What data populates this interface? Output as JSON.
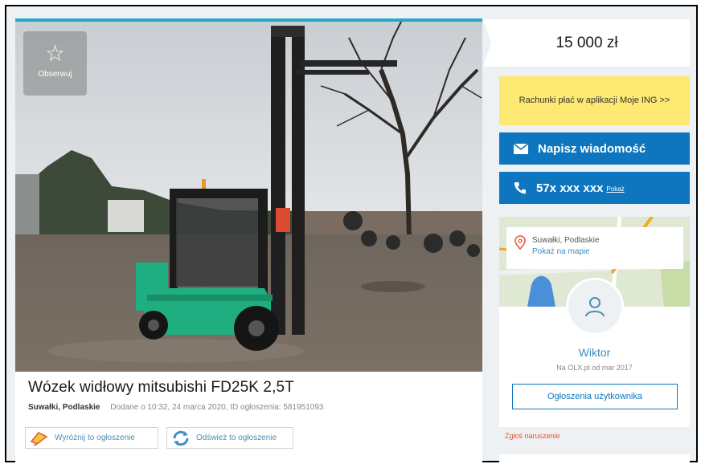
{
  "listing": {
    "title": "Wózek widłowy mitsubishi FD25K 2,5T",
    "location": "Suwałki, Podlaskie",
    "meta": "Dodane o 10:32, 24 marca 2020, ID ogłoszenia: 581951093",
    "follow_label": "Obserwuj",
    "promote_label": "Wyróżnij to ogłoszenie",
    "refresh_label": "Odśwież to ogłoszenie"
  },
  "sidebar": {
    "price": "15 000 zł",
    "bank_banner": "Rachunki płać w aplikacji Moje ING >>",
    "message_label": "Napisz wiadomość",
    "phone_label": "57x xxx xxx",
    "phone_show": "Pokaż",
    "map_city": "Suwałki, Podlaskie",
    "map_link": "Pokaż na mapie",
    "user_name": "Wiktor",
    "user_since": "Na OLX.pl od mar 2017",
    "user_ads_label": "Ogłoszenia użytkownika",
    "report_label": "Zgłoś naruszenie"
  },
  "colors": {
    "accent": "#0e76be",
    "banner": "#fde872",
    "link": "#3a8fc4",
    "report": "#e0553a",
    "forklift": "#1fae80"
  },
  "icons": [
    "star-icon",
    "envelope-icon",
    "phone-icon",
    "pin-icon",
    "user-icon",
    "promote-icon",
    "refresh-icon"
  ]
}
